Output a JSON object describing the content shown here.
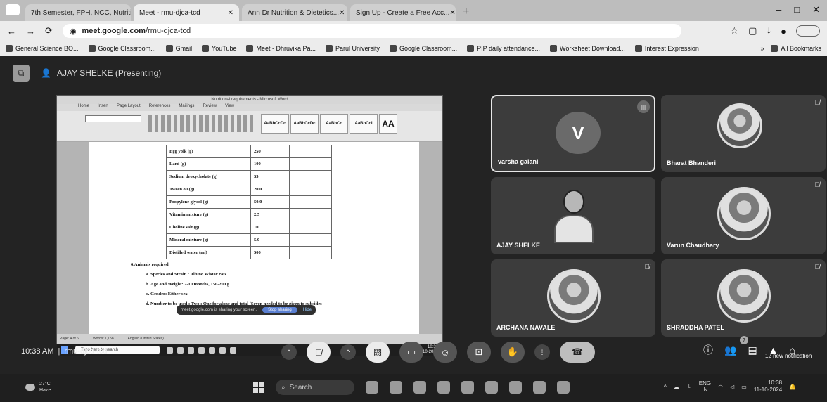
{
  "browser": {
    "tabs": [
      {
        "title": "7th Semester, FPH, NCC, Nutrition..."
      },
      {
        "title": "Meet - rmu-djca-tcd"
      },
      {
        "title": "Ann Dr Nutrition & Dietetics..."
      },
      {
        "title": "Sign Up - Create a Free Acc..."
      }
    ],
    "url_host": "meet.google.com",
    "url_path": "/rmu-djca-tcd",
    "bookmarks": [
      "General Science BO...",
      "Google Classroom...",
      "Gmail",
      "YouTube",
      "Meet - Dhruvika Pa...",
      "Parul University",
      "Google Classroom...",
      "PIP daily attendance...",
      "Worksheet Download...",
      "Interest Expression"
    ],
    "all_bookmarks": "All Bookmarks"
  },
  "meet": {
    "presenter_label": "AJAY SHELKE (Presenting)",
    "meeting_time": "10:38 AM",
    "meeting_code": "rmu-djca-tcd",
    "people_count": "7",
    "notification": "12 new notification",
    "participants": [
      {
        "name": "varsha galani",
        "initial": "V",
        "speaking": true
      },
      {
        "name": "Bharat Bhanderi",
        "muted": true
      },
      {
        "name": "AJAY SHELKE"
      },
      {
        "name": "Varun Chaudhary",
        "muted": true
      },
      {
        "name": "ARCHANA NAVALE",
        "muted": true
      },
      {
        "name": "SHRADDHA PATEL",
        "muted": true
      }
    ]
  },
  "shared_screen": {
    "window_title": "Nutritional requirements - Microsoft Word",
    "ribbon_tabs": [
      "Home",
      "Insert",
      "Page Layout",
      "References",
      "Mailings",
      "Review",
      "View"
    ],
    "styles": [
      "AaBbCcDc",
      "AaBbCcDc",
      "AaBbCc",
      "AaBbCcI",
      "AA"
    ],
    "table_rows": [
      {
        "name": "Egg yolk (g)",
        "value": "250"
      },
      {
        "name": "Lard (g)",
        "value": "100"
      },
      {
        "name": "Sodium deoxycholate (g)",
        "value": "35"
      },
      {
        "name": "Tween 80 (g)",
        "value": "20.0"
      },
      {
        "name": "Propylene glycol (g)",
        "value": "50.0"
      },
      {
        "name": "Vitamin mixture (g)",
        "value": "2.5"
      },
      {
        "name": "Choline salt (g)",
        "value": "10"
      },
      {
        "name": "Mineral mixture (g)",
        "value": "5.0"
      },
      {
        "name": "Distilled water (ml)",
        "value": "500"
      }
    ],
    "section_heading": "6.Animals required",
    "list_items": [
      "Species and Strain : Albino Wistar rats",
      "Age and Weight: 2-10 months, 150-200 g",
      "Gender: Either sex",
      "Number to be used : Two : One for alone and total (Seven needed to be given to subsides"
    ],
    "share_banner": {
      "text": "meet.google.com is sharing your screen.",
      "stop": "Stop sharing",
      "hide": "Hide"
    },
    "status_text": [
      "Page: 4 of 6",
      "Words: 1,158",
      "English (United States)"
    ],
    "inner_search": "Type here to search",
    "inner_clock_time": "10:38",
    "inner_clock_date": "11-10-2024"
  },
  "taskbar": {
    "weather_temp": "27°C",
    "weather_desc": "Haze",
    "search": "Search",
    "lang1": "ENG",
    "lang2": "IN",
    "time": "10:38",
    "date": "11-10-2024"
  }
}
